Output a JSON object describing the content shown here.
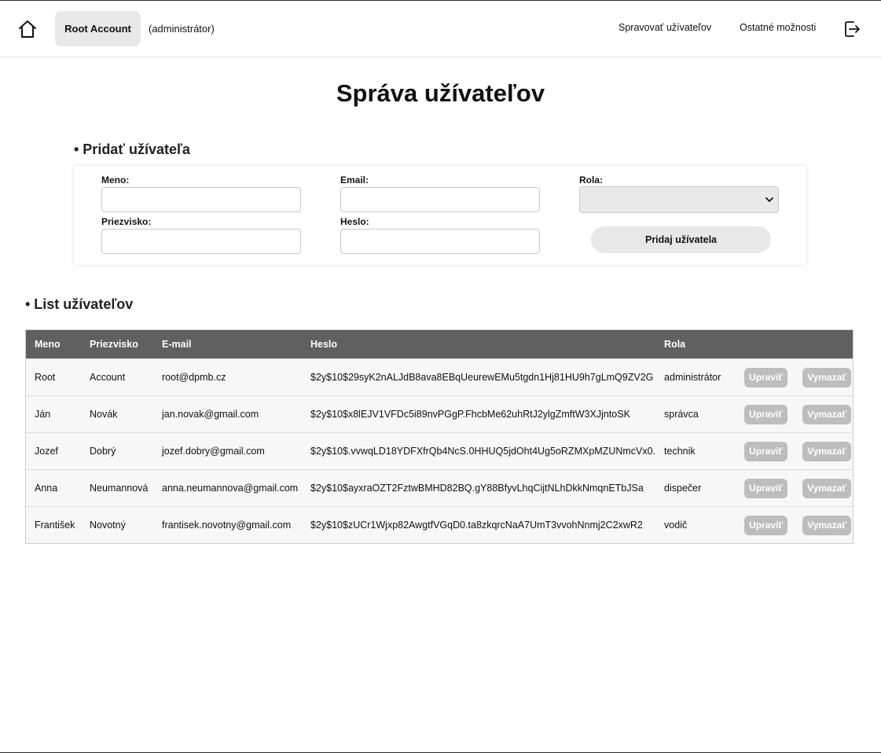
{
  "nav": {
    "account_name": "Root Account",
    "account_role": "(administrátor)",
    "manage_users": "Spravovať užívateľov",
    "other_options": "Ostatné možnosti"
  },
  "page": {
    "title": "Správa užívateľov"
  },
  "add_section": {
    "title": "• Pridať užívateľa",
    "name_label": "Meno:",
    "name_value": "",
    "surname_label": "Priezvisko:",
    "surname_value": "",
    "email_label": "Email:",
    "email_value": "",
    "password_label": "Heslo:",
    "password_value": "",
    "role_label": "Rola:",
    "role_selected": "",
    "submit_label": "Pridaj užívatela"
  },
  "list_section": {
    "title": "• List užívateľov",
    "columns": [
      "Meno",
      "Priezvisko",
      "E-mail",
      "Heslo",
      "Rola",
      ""
    ],
    "edit_label": "Upraviť",
    "delete_label": "Vymazať",
    "rows": [
      {
        "name": "Root",
        "surname": "Account",
        "email": "root@dpmb.cz",
        "password": "$2y$10$29syK2nALJdB8ava8EBqUeurewEMu5tgdn1Hj81HU9h7gLmQ9ZV2G",
        "role": "administrátor"
      },
      {
        "name": "Ján",
        "surname": "Novák",
        "email": "jan.novak@gmail.com",
        "password": "$2y$10$x8lEJV1VFDc5i89nvPGgP.FhcbMe62uhRtJ2ylgZmftW3XJjntoSK",
        "role": "správca"
      },
      {
        "name": "Jozef",
        "surname": "Dobrý",
        "email": "jozef.dobry@gmail.com",
        "password": "$2y$10$.vvwqLD18YDFXfrQb4NcS.0HHUQ5jdOht4Ug5oRZMXpMZUNmcVx0.",
        "role": "technik"
      },
      {
        "name": "Anna",
        "surname": "Neumannová",
        "email": "anna.neumannova@gmail.com",
        "password": "$2y$10$ayxraOZT2FztwBMHD82BQ.gY88BfyvLhqCijtNLhDkkNmqnETbJSa",
        "role": "dispečer"
      },
      {
        "name": "František",
        "surname": "Novotný",
        "email": "frantisek.novotny@gmail.com",
        "password": "$2y$10$zUCr1Wjxp82AwgtfVGqD0.ta8zkqrcNaA7UmT3vvohNnmj2C2xwR2",
        "role": "vodič"
      }
    ]
  }
}
